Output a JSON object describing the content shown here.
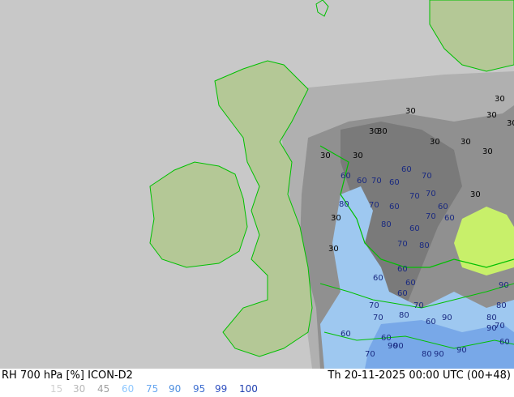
{
  "product": {
    "left_title": "RH 700 hPa [%] ICON-D2",
    "right_title": "Th 20-11-2025 00:00 UTC (00+48)"
  },
  "legend": [
    {
      "label": "15",
      "color": "#d0d0d0"
    },
    {
      "label": "30",
      "color": "#b8b8b8"
    },
    {
      "label": "45",
      "color": "#a0a0a0"
    },
    {
      "label": "60",
      "color": "#8ec8ff"
    },
    {
      "label": "75",
      "color": "#6aa8f0"
    },
    {
      "label": "90",
      "color": "#5090e0"
    },
    {
      "label": "95",
      "color": "#4070d0"
    },
    {
      "label": "99",
      "color": "#3050c0"
    },
    {
      "label": "100",
      "color": "#2040b0"
    }
  ],
  "colors": {
    "outside_domain": "#c8c8c8",
    "coastline": "#00c000",
    "land_outside": "#b4c896",
    "grey_low": "#a8a8a8",
    "grey_mid": "#8c8c8c",
    "grey_dark": "#707070",
    "blue_light": "#9ec8f0",
    "blue_mid": "#78a8e8",
    "green_patch": "#c8f06a"
  },
  "contour_labels": [
    "30",
    "30",
    "30",
    "30",
    "30",
    "30",
    "30",
    "30",
    "30",
    "30",
    "30",
    "30",
    "30",
    "30",
    "60",
    "70",
    "60",
    "60",
    "70",
    "60",
    "80",
    "70",
    "60",
    "70",
    "70",
    "60",
    "60",
    "70",
    "60",
    "80",
    "70",
    "80",
    "60",
    "60",
    "70",
    "60",
    "60",
    "70",
    "80",
    "60",
    "70",
    "60",
    "90",
    "80",
    "70",
    "60",
    "90",
    "90",
    "80",
    "90",
    "90",
    "60",
    "70",
    "90",
    "80",
    "90"
  ]
}
